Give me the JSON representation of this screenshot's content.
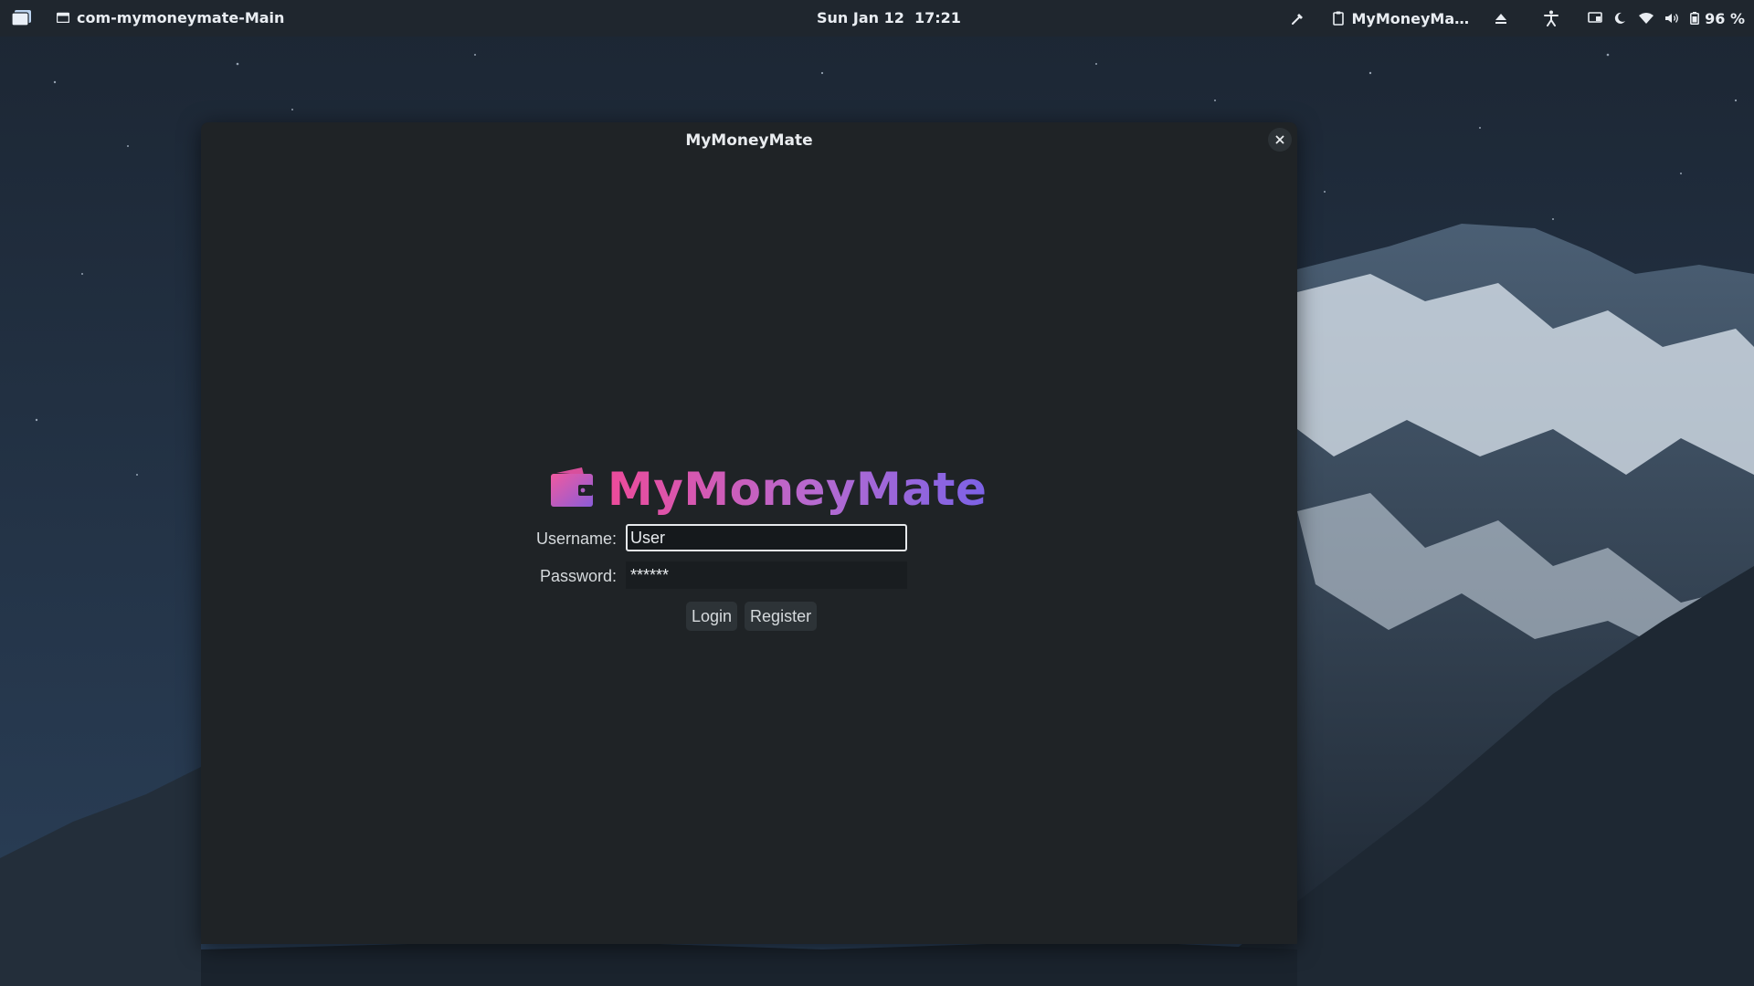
{
  "topbar": {
    "app_indicator": "com-mymoneymate-Main",
    "clock": "Sun Jan 12  17:21",
    "tray_app": "MyMoneyMa…",
    "battery": "96 %"
  },
  "window": {
    "title": "MyMoneyMate",
    "brand": "MyMoneyMate"
  },
  "login": {
    "username_label": "Username:",
    "username_value": "User",
    "password_label": "Password:",
    "password_value": "******",
    "login_button": "Login",
    "register_button": "Register"
  },
  "colors": {
    "brand_gradient": [
      "#ec4b9a",
      "#b66ad0",
      "#7c62e6"
    ],
    "window_bg": "#1f2326",
    "panel_bg": "#1f262e"
  },
  "icons": [
    "launcher-icon",
    "app-window-icon",
    "color-picker-icon",
    "clipboard-icon",
    "eject-icon",
    "accessibility-icon",
    "screen-icon",
    "night-mode-icon",
    "wifi-icon",
    "volume-icon",
    "battery-icon",
    "close-icon",
    "wallet-logo-icon"
  ]
}
